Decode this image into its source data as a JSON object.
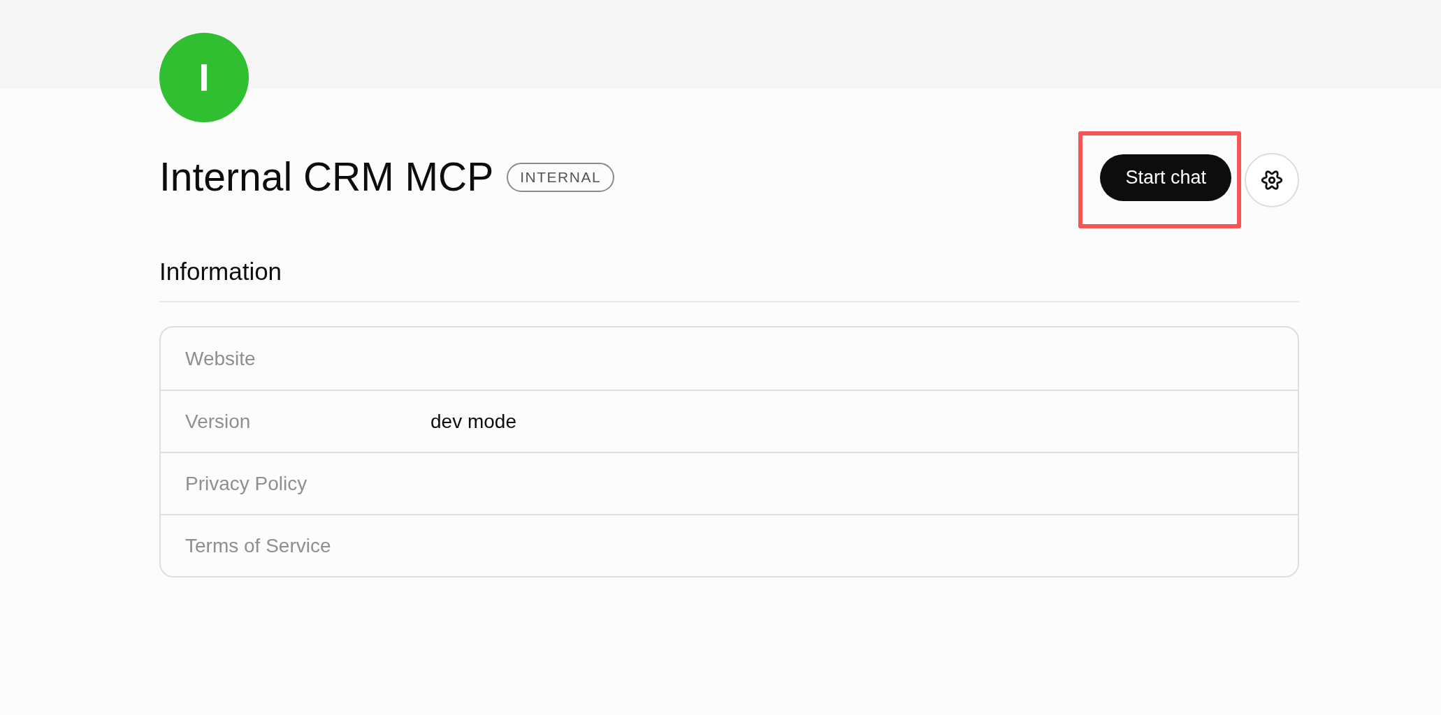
{
  "server": {
    "avatar": {
      "initial": "I"
    },
    "title": "Internal CRM MCP",
    "badge": "INTERNAL"
  },
  "actions": {
    "start_chat": {
      "label": "Start chat",
      "highlighted": true
    }
  },
  "information": {
    "title": "Information",
    "rows": [
      {
        "label": "Website"
      },
      {
        "label": "Version",
        "value": "dev mode"
      },
      {
        "label": "Privacy Policy"
      },
      {
        "label": "Terms of Service"
      }
    ]
  }
}
